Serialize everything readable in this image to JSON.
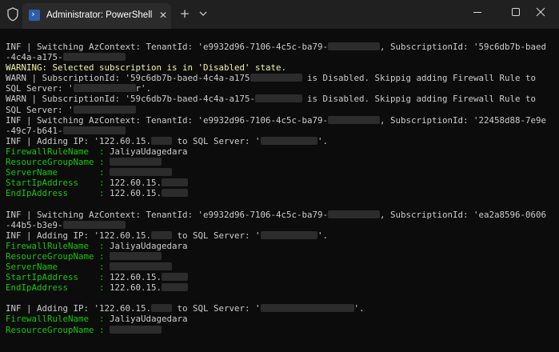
{
  "window": {
    "tab_title": "Administrator: PowerShell",
    "tab_close": "✕",
    "new_tab": "+",
    "icons": {
      "shield": "shield-icon",
      "powershell": "powershell-icon",
      "dropdown": "chevron-down-icon",
      "minimize": "minimize-icon",
      "maximize": "maximize-icon",
      "close": "close-icon"
    }
  },
  "colors": {
    "background": "#0c0c0c",
    "titlebar": "#202020",
    "tab": "#2b2b2b",
    "text": "#cccccc",
    "property": "#16c60c",
    "warning": "#f9f1a5",
    "redacted": "#2c2c2c"
  },
  "console": {
    "lines": [
      [
        {
          "t": "INF | Switching AzContext: TenantId: 'e9932d96-7106-4c5c-ba79-",
          "c": "gray"
        },
        {
          "blur": 10
        },
        {
          "t": ", SubscriptionId: '59c6db7b-baed",
          "c": "gray"
        }
      ],
      [
        {
          "t": "-4c4a-a175-",
          "c": "gray"
        },
        {
          "blur": 12
        }
      ],
      [
        {
          "t": "WARNING: Selected subscription is in 'Disabled' state.",
          "c": "yellow"
        }
      ],
      [
        {
          "t": "WARN | SubscriptionId: '59c6db7b-baed-4c4a-a175",
          "c": "gray"
        },
        {
          "blur": 10
        },
        {
          "t": " is Disabled. Skippig adding Firewall Rule to",
          "c": "gray"
        }
      ],
      [
        {
          "t": "SQL Server: '",
          "c": "gray"
        },
        {
          "blur": 12
        },
        {
          "t": "r'.",
          "c": "gray"
        }
      ],
      [
        {
          "t": "WARN | SubscriptionId: '59c6db7b-baed-4c4a-a175-",
          "c": "gray"
        },
        {
          "blur": 9
        },
        {
          "t": " is Disabled. Skippig adding Firewall Rule to",
          "c": "gray"
        }
      ],
      [
        {
          "t": "SQL Server: '",
          "c": "gray"
        },
        {
          "blur": 12
        }
      ],
      [
        {
          "t": "INF | Switching AzContext: TenantId: 'e9932d96-7106-4c5c-ba79-",
          "c": "gray"
        },
        {
          "blur": 10
        },
        {
          "t": ", SubscriptionId: '22458d88-7e9e",
          "c": "gray"
        }
      ],
      [
        {
          "t": "-49c7-b641-",
          "c": "gray"
        },
        {
          "blur": 12
        }
      ],
      [
        {
          "t": "INF | Adding IP: '122.60.15.",
          "c": "gray"
        },
        {
          "blur": 4
        },
        {
          "t": " to SQL Server: '",
          "c": "gray"
        },
        {
          "blur": 11
        },
        {
          "t": "'.",
          "c": "gray"
        }
      ],
      [
        {
          "t": "FirewallRuleName  : ",
          "c": "green"
        },
        {
          "t": "JaliyaUdagedara",
          "c": "gray"
        }
      ],
      [
        {
          "t": "ResourceGroupName : ",
          "c": "green"
        },
        {
          "blur": 10
        }
      ],
      [
        {
          "t": "ServerName        : ",
          "c": "green"
        },
        {
          "blur": 12
        }
      ],
      [
        {
          "t": "StartIpAddress    : ",
          "c": "green"
        },
        {
          "t": "122.60.15.",
          "c": "gray"
        },
        {
          "blur": 5
        }
      ],
      [
        {
          "t": "EndIpAddress      : ",
          "c": "green"
        },
        {
          "t": "122.60.15.",
          "c": "gray"
        },
        {
          "blur": 5
        }
      ],
      [],
      [
        {
          "t": "INF | Switching AzContext: TenantId: 'e9932d96-7106-4c5c-ba79-",
          "c": "gray"
        },
        {
          "blur": 10
        },
        {
          "t": ", SubscriptionId: 'ea2a8596-0606",
          "c": "gray"
        }
      ],
      [
        {
          "t": "-44b5-b3e9-",
          "c": "gray"
        },
        {
          "blur": 12
        }
      ],
      [
        {
          "t": "INF | Adding IP: '122.60.15.",
          "c": "gray"
        },
        {
          "blur": 4
        },
        {
          "t": " to SQL Server: '",
          "c": "gray"
        },
        {
          "blur": 11
        },
        {
          "t": "'.",
          "c": "gray"
        }
      ],
      [
        {
          "t": "FirewallRuleName  : ",
          "c": "green"
        },
        {
          "t": "JaliyaUdagedara",
          "c": "gray"
        }
      ],
      [
        {
          "t": "ResourceGroupName : ",
          "c": "green"
        },
        {
          "blur": 10
        }
      ],
      [
        {
          "t": "ServerName        : ",
          "c": "green"
        },
        {
          "blur": 12
        }
      ],
      [
        {
          "t": "StartIpAddress    : ",
          "c": "green"
        },
        {
          "t": "122.60.15.",
          "c": "gray"
        },
        {
          "blur": 5
        }
      ],
      [
        {
          "t": "EndIpAddress      : ",
          "c": "green"
        },
        {
          "t": "122.60.15.",
          "c": "gray"
        },
        {
          "blur": 5
        }
      ],
      [],
      [
        {
          "t": "INF | Adding IP: '122.60.15.",
          "c": "gray"
        },
        {
          "blur": 4
        },
        {
          "t": " to SQL Server: '",
          "c": "gray"
        },
        {
          "blur": 18
        },
        {
          "t": "'.",
          "c": "gray"
        }
      ],
      [
        {
          "t": "FirewallRuleName  : ",
          "c": "green"
        },
        {
          "t": "JaliyaUdagedara",
          "c": "gray"
        }
      ],
      [
        {
          "t": "ResourceGroupName : ",
          "c": "green"
        },
        {
          "blur": 10
        }
      ]
    ]
  }
}
